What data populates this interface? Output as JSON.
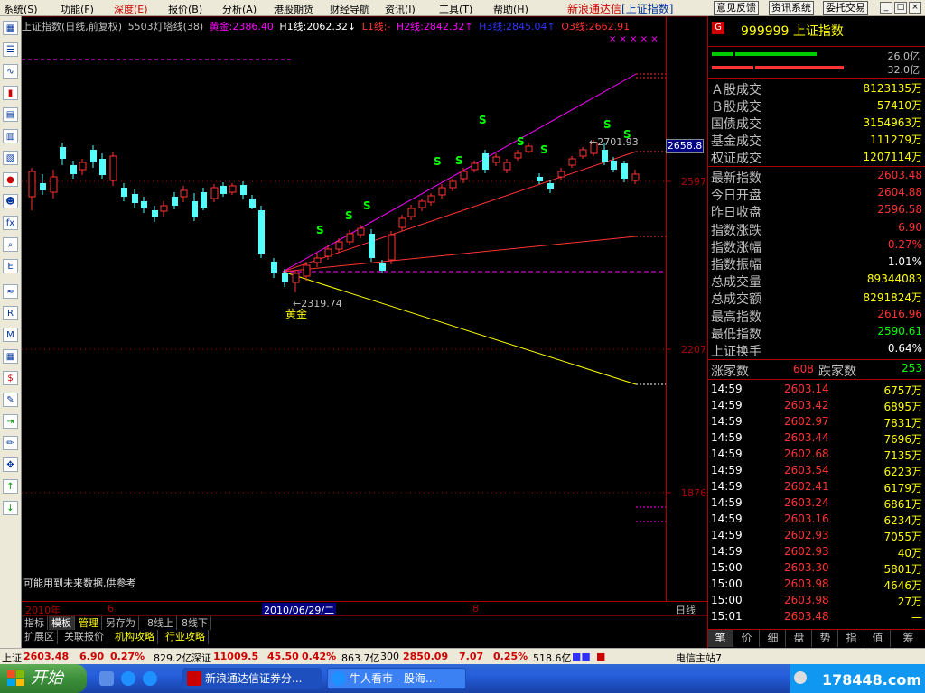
{
  "menu": {
    "items": [
      "系统(S)",
      "功能(F)",
      "深度(E)",
      "报价(B)",
      "分析(A)",
      "港股期货",
      "财经导航",
      "资讯(I)",
      "工具(T)",
      "帮助(H)"
    ],
    "app_title": "新浪通达信",
    "app_symbol": "[上证指数]",
    "buttons": [
      "意见反馈",
      "资讯系统",
      "委托交易"
    ]
  },
  "chart": {
    "info": {
      "name": "上证指数(日线,前复权)",
      "indicator": "5503灯塔线(38)",
      "gold": "黄金:2386.40",
      "h1": "H1线:2062.32↓",
      "l1": "L1线:-",
      "h2": "H2线:2842.32↑",
      "h3": "H3线:2845.04↑",
      "o3": "O3线:2662.91"
    },
    "price_labels": {
      "p2658": "2658.8",
      "p2597": "2597",
      "p2207": "2207",
      "p1876": "1876"
    },
    "annotations": {
      "high": "2701.93",
      "low": "2319.74",
      "gold_marker": "黄金",
      "signal": "S"
    },
    "note": "可能用到未来数据,供参考"
  },
  "chart_data": {
    "type": "candlestick",
    "period": "日线",
    "visible_labels": [
      "2701.93",
      "2319.74",
      "2658.8",
      "2597",
      "2207",
      "1876"
    ]
  },
  "xaxis": {
    "year": "2010年",
    "m6": "6",
    "date": "2010/06/29/二",
    "m8": "8",
    "period": "日线"
  },
  "tabs1": [
    "指标",
    "模板",
    "管理",
    "另存为",
    "8线上",
    "8线下"
  ],
  "tabs2": [
    "扩展区",
    "关联报价",
    "机构攻略",
    "行业攻略"
  ],
  "right": {
    "g": "G",
    "code": "999999 上证指数",
    "vol1": "26.0亿",
    "vol2": "32.0亿",
    "stats1": [
      {
        "label": "Ａ股成交",
        "value": "8123135万",
        "color": "#ff0"
      },
      {
        "label": "Ｂ股成交",
        "value": "57410万",
        "color": "#ff0"
      },
      {
        "label": "国债成交",
        "value": "3154963万",
        "color": "#ff0"
      },
      {
        "label": "基金成交",
        "value": "111279万",
        "color": "#ff0"
      },
      {
        "label": "权证成交",
        "value": "1207114万",
        "color": "#ff0"
      }
    ],
    "stats2": [
      {
        "label": "最新指数",
        "value": "2603.48",
        "color": "#f33"
      },
      {
        "label": "今日开盘",
        "value": "2604.88",
        "color": "#f33"
      },
      {
        "label": "昨日收盘",
        "value": "2596.58",
        "color": "#f33"
      },
      {
        "label": "指数涨跌",
        "value": "6.90",
        "color": "#f33"
      },
      {
        "label": "指数涨幅",
        "value": "0.27%",
        "color": "#f33"
      },
      {
        "label": "指数振幅",
        "value": "1.01%",
        "color": "#fff"
      },
      {
        "label": "总成交量",
        "value": "89344083",
        "color": "#ff0"
      },
      {
        "label": "总成交额",
        "value": "8291824万",
        "color": "#ff0"
      },
      {
        "label": "最高指数",
        "value": "2616.96",
        "color": "#f33"
      },
      {
        "label": "最低指数",
        "value": "2590.61",
        "color": "#0f0"
      },
      {
        "label": "上证换手",
        "value": "0.64%",
        "color": "#fff"
      }
    ],
    "updown": {
      "up_label": "涨家数",
      "up": "608",
      "down_label": "跌家数",
      "down": "253"
    },
    "ticks": [
      {
        "t": "14:59",
        "p": "2603.14",
        "v": "6757万"
      },
      {
        "t": "14:59",
        "p": "2603.42",
        "v": "6895万"
      },
      {
        "t": "14:59",
        "p": "2602.97",
        "v": "7831万"
      },
      {
        "t": "14:59",
        "p": "2603.44",
        "v": "7696万"
      },
      {
        "t": "14:59",
        "p": "2602.68",
        "v": "7135万"
      },
      {
        "t": "14:59",
        "p": "2603.54",
        "v": "6223万"
      },
      {
        "t": "14:59",
        "p": "2602.41",
        "v": "6179万"
      },
      {
        "t": "14:59",
        "p": "2603.24",
        "v": "6861万"
      },
      {
        "t": "14:59",
        "p": "2603.16",
        "v": "6234万"
      },
      {
        "t": "14:59",
        "p": "2602.93",
        "v": "7055万"
      },
      {
        "t": "14:59",
        "p": "2602.93",
        "v": "40万"
      },
      {
        "t": "15:00",
        "p": "2603.30",
        "v": "5801万"
      },
      {
        "t": "15:00",
        "p": "2603.98",
        "v": "4646万"
      },
      {
        "t": "15:00",
        "p": "2603.98",
        "v": "27万"
      },
      {
        "t": "15:01",
        "p": "2603.48",
        "v": "一"
      }
    ],
    "tabs": [
      "笔",
      "价",
      "细",
      "盘",
      "势",
      "指",
      "值",
      "筹"
    ]
  },
  "status": {
    "sh_label": "上证",
    "sh_price": "2603.48",
    "sh_chg": "6.90",
    "sh_pct": "0.27%",
    "sh_amt": "829.2亿",
    "sz_label": "深证",
    "sz_price": "11009.5",
    "sz_chg": "45.50",
    "sz_pct": "0.42%",
    "sz_amt": "863.7亿",
    "i300_label": "300",
    "i300_price": "2850.09",
    "i300_chg": "7.07",
    "i300_pct": "0.25%",
    "i300_amt": "518.6亿",
    "server": "电信主站7"
  },
  "taskbar": {
    "start": "开始",
    "task1": "新浪通达信证券分...",
    "task2": "牛人看市 - 股海...",
    "watermark": "178448.com"
  },
  "colors": {
    "up": "#ff3232",
    "down": "#54ffff",
    "gold": "#ffff00",
    "magenta": "#ff00ff"
  }
}
